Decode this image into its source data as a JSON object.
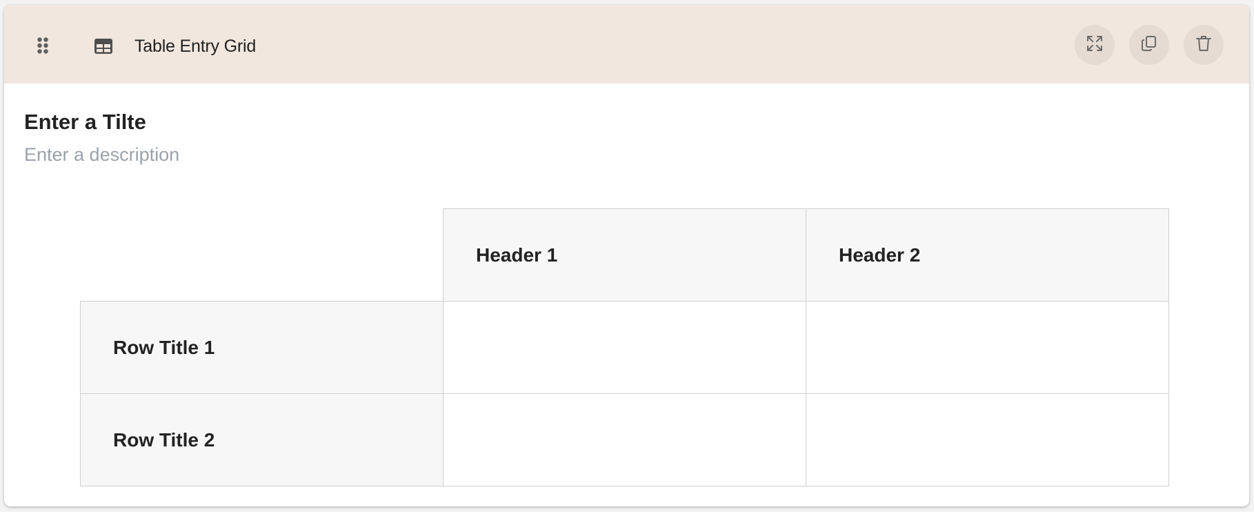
{
  "component": {
    "type_label": "Table Entry Grid",
    "drag_icon": "drag-handle-icon",
    "type_icon": "table-icon",
    "actions": [
      {
        "name": "expand",
        "icon": "expand-icon"
      },
      {
        "name": "copy",
        "icon": "copy-icon"
      },
      {
        "name": "delete",
        "icon": "trash-icon"
      }
    ]
  },
  "question": {
    "title": "Enter a Tilte",
    "description": "Enter a description"
  },
  "grid": {
    "column_headers": [
      "Header 1",
      "Header 2"
    ],
    "row_titles": [
      "Row Title 1",
      "Row Title 2"
    ],
    "cells": [
      [
        "",
        ""
      ],
      [
        "",
        ""
      ]
    ]
  },
  "colors": {
    "header_background": "#f1e7df",
    "action_button_background": "#e6dbd2",
    "header_cell_background": "#f7f7f7",
    "grid_border": "#cfcfcf",
    "description_text": "#9aa2aa"
  }
}
